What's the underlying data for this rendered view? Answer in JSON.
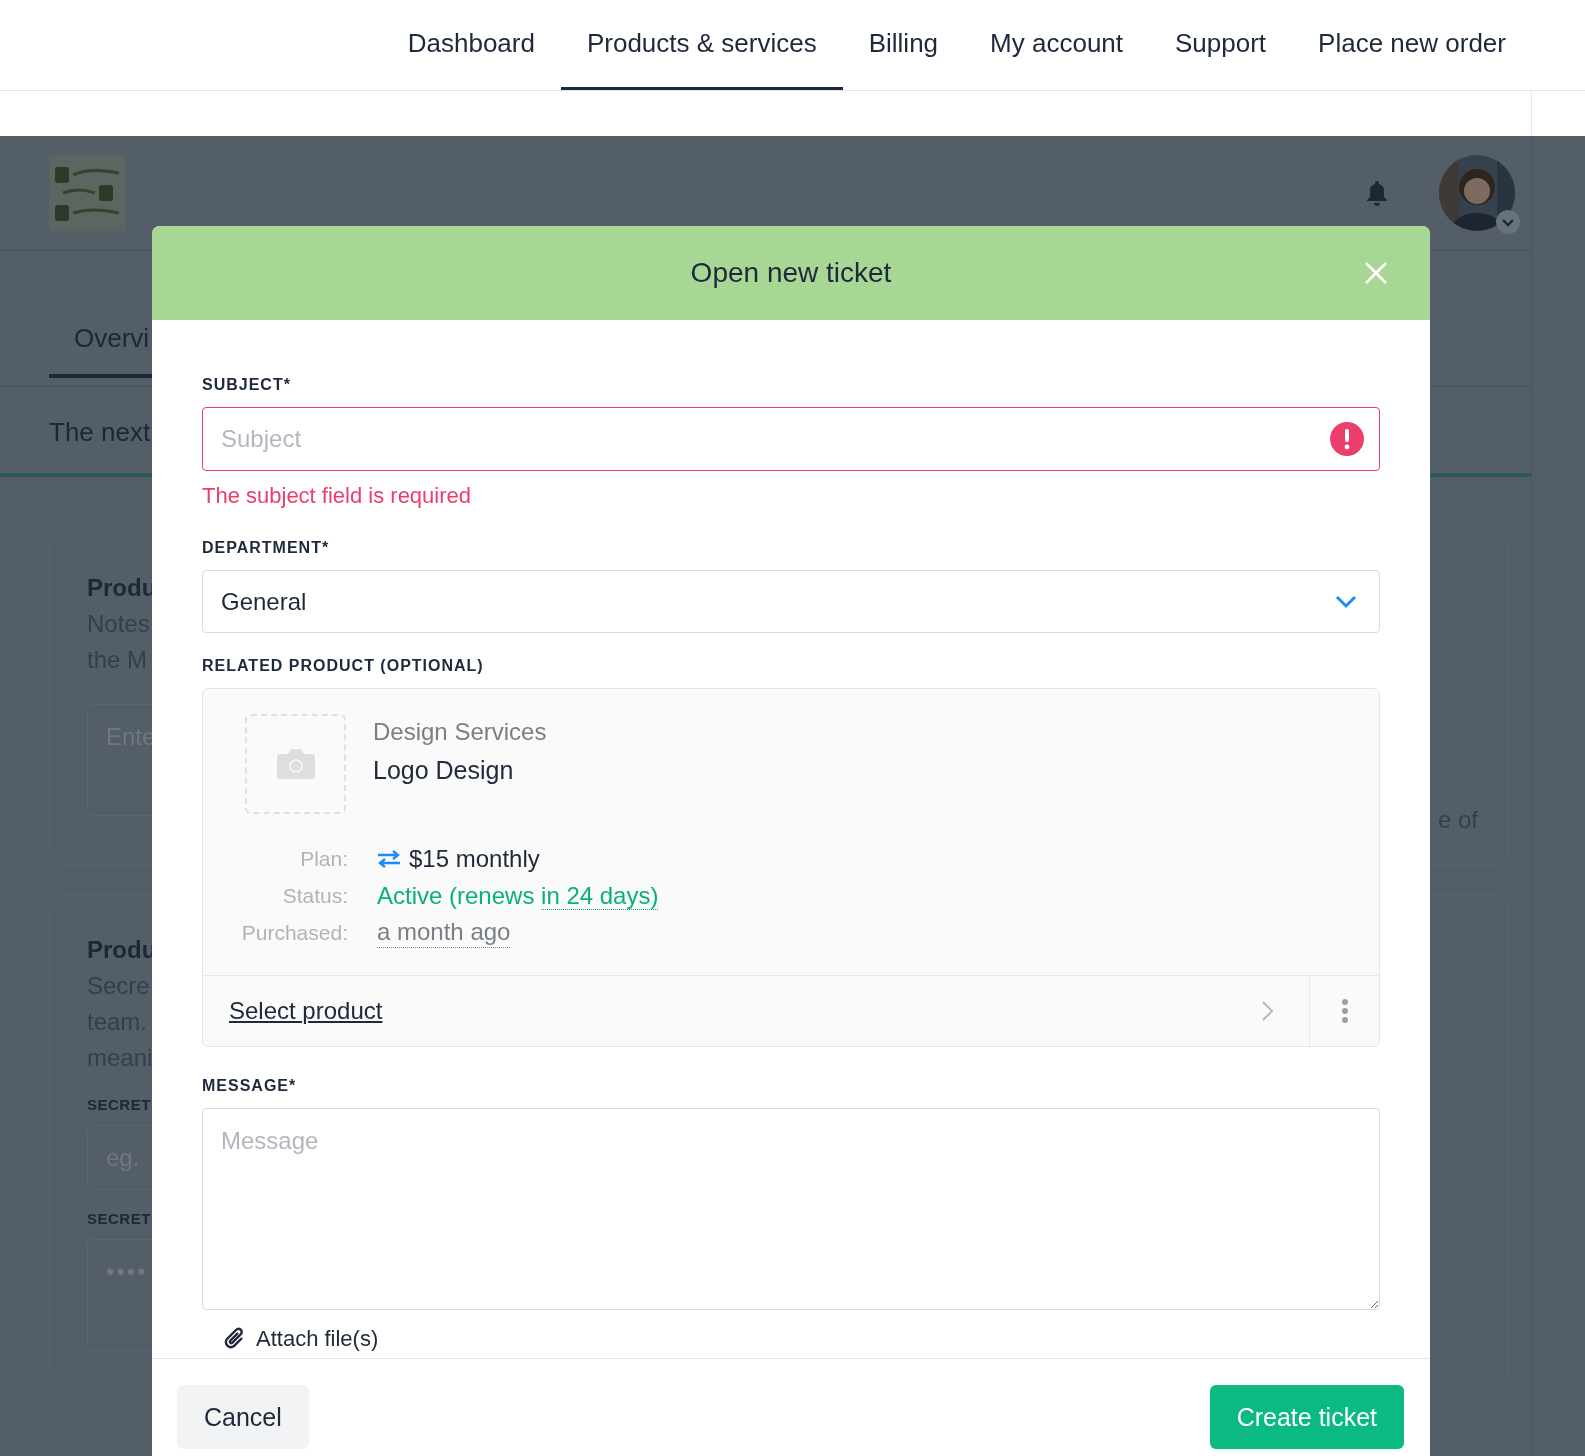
{
  "nav": [
    {
      "label": "Dashboard",
      "selected": false
    },
    {
      "label": "Products & services",
      "selected": true
    },
    {
      "label": "Billing",
      "selected": false
    },
    {
      "label": "My account",
      "selected": false
    },
    {
      "label": "Support",
      "selected": false
    },
    {
      "label": "Place new order",
      "selected": false
    }
  ],
  "background": {
    "tab": "Overvi",
    "intro": "The next",
    "side_text": "e of",
    "cards": [
      {
        "title": "Produ",
        "lines": [
          "Notes",
          "the M"
        ],
        "fields": [
          {
            "kind": "area",
            "placeholder": "Ente"
          }
        ]
      },
      {
        "title": "Produ",
        "lines": [
          "Secre",
          "team.",
          "meani"
        ],
        "fields": [
          {
            "kind": "input",
            "label": "SECRET",
            "placeholder": "eg."
          },
          {
            "kind": "secret",
            "label": "SECRET",
            "placeholder": "••••"
          }
        ]
      }
    ]
  },
  "modal": {
    "title": "Open new ticket",
    "subject": {
      "label": "SUBJECT*",
      "placeholder": "Subject",
      "invalid": true,
      "error": "The subject field is required"
    },
    "department": {
      "label": "DEPARTMENT*",
      "value": "General"
    },
    "related": {
      "label": "RELATED PRODUCT (OPTIONAL)",
      "category": "Design Services",
      "name": "Logo Design",
      "details": [
        {
          "kind": "plan",
          "label": "Plan:",
          "value": "$15 monthly"
        },
        {
          "kind": "status",
          "label": "Status:",
          "value": "Active (renews",
          "hint": "in 24 days)"
        },
        {
          "kind": "date",
          "label": "Purchased:",
          "value": "a month ago"
        }
      ],
      "select": "Select product"
    },
    "message": {
      "label": "MESSAGE*",
      "placeholder": "Message"
    },
    "attach": "Attach file(s)",
    "cancel": "Cancel",
    "submit": "Create ticket"
  }
}
